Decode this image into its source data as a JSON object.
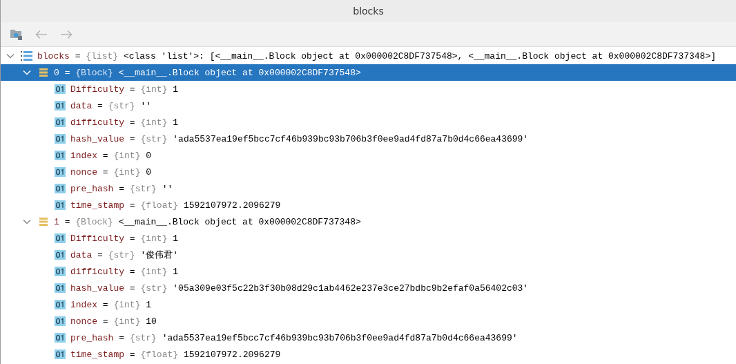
{
  "window": {
    "title": "blocks"
  },
  "toolbar": {
    "back": {
      "disabled": true
    },
    "forward": {
      "disabled": true
    }
  },
  "tree": [
    {
      "name": "blocks",
      "eq": "=",
      "type": "{list}",
      "value": "<class 'list'>: [<__main__.Block object at 0x000002C8DF737548>, <__main__.Block object at 0x000002C8DF737348>]",
      "kind": "list",
      "expanded": true,
      "selected": false,
      "children": [
        {
          "name": "0",
          "eq": "=",
          "type": "{Block}",
          "value": "<__main__.Block object at 0x000002C8DF737548>",
          "kind": "object",
          "expanded": true,
          "selected": true,
          "children": [
            {
              "name": "Difficulty",
              "eq": "=",
              "type": "{int}",
              "value": "1",
              "kind": "primitive",
              "selected": false
            },
            {
              "name": "data",
              "eq": "=",
              "type": "{str}",
              "value": "''",
              "kind": "primitive",
              "selected": false
            },
            {
              "name": "difficulty",
              "eq": "=",
              "type": "{int}",
              "value": "1",
              "kind": "primitive",
              "selected": false
            },
            {
              "name": "hash_value",
              "eq": "=",
              "type": "{str}",
              "value": "'ada5537ea19ef5bcc7cf46b939bc93b706b3f0ee9ad4fd87a7b0d4c66ea43699'",
              "kind": "primitive",
              "selected": false
            },
            {
              "name": "index",
              "eq": "=",
              "type": "{int}",
              "value": "0",
              "kind": "primitive",
              "selected": false
            },
            {
              "name": "nonce",
              "eq": "=",
              "type": "{int}",
              "value": "0",
              "kind": "primitive",
              "selected": false
            },
            {
              "name": "pre_hash",
              "eq": "=",
              "type": "{str}",
              "value": "''",
              "kind": "primitive",
              "selected": false
            },
            {
              "name": "time_stamp",
              "eq": "=",
              "type": "{float}",
              "value": "1592107972.2096279",
              "kind": "primitive",
              "selected": false
            }
          ]
        },
        {
          "name": "1",
          "eq": "=",
          "type": "{Block}",
          "value": "<__main__.Block object at 0x000002C8DF737348>",
          "kind": "object",
          "expanded": true,
          "selected": false,
          "children": [
            {
              "name": "Difficulty",
              "eq": "=",
              "type": "{int}",
              "value": "1",
              "kind": "primitive",
              "selected": false
            },
            {
              "name": "data",
              "eq": "=",
              "type": "{str}",
              "value": "'俊伟君'",
              "kind": "primitive",
              "selected": false
            },
            {
              "name": "difficulty",
              "eq": "=",
              "type": "{int}",
              "value": "1",
              "kind": "primitive",
              "selected": false
            },
            {
              "name": "hash_value",
              "eq": "=",
              "type": "{str}",
              "value": "'05a309e03f5c22b3f30b08d29c1ab4462e237e3ce27bdbc9b2efaf0a56402c03'",
              "kind": "primitive",
              "selected": false
            },
            {
              "name": "index",
              "eq": "=",
              "type": "{int}",
              "value": "1",
              "kind": "primitive",
              "selected": false
            },
            {
              "name": "nonce",
              "eq": "=",
              "type": "{int}",
              "value": "10",
              "kind": "primitive",
              "selected": false
            },
            {
              "name": "pre_hash",
              "eq": "=",
              "type": "{str}",
              "value": "'ada5537ea19ef5bcc7cf46b939bc93b706b3f0ee9ad4fd87a7b0d4c66ea43699'",
              "kind": "primitive",
              "selected": false
            },
            {
              "name": "time_stamp",
              "eq": "=",
              "type": "{float}",
              "value": "1592107972.2096279",
              "kind": "primitive",
              "selected": false
            }
          ]
        }
      ]
    }
  ]
}
